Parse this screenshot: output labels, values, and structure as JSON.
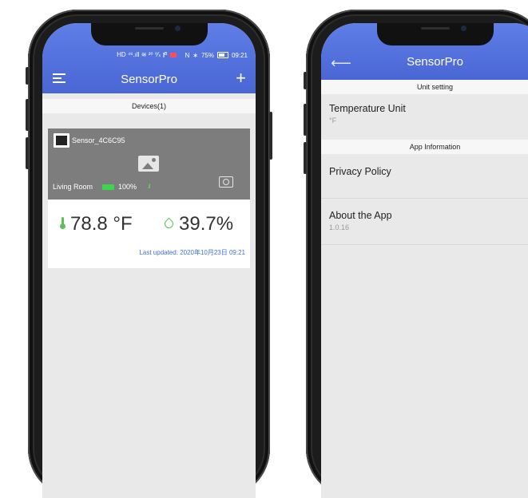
{
  "left_screen": {
    "status_bar": {
      "left_icons": "HD ⁴⁶.ıll ≋ ²⁰ ⁰⁄ₛ ⫾ᴮ",
      "nfc": "N",
      "bluetooth": "∗",
      "battery_pct": "75%",
      "time": "09:21"
    },
    "title": "SensorPro",
    "devices_label": "Devices(1)",
    "device": {
      "name": "Sensor_4C6C95",
      "room": "Living Room",
      "battery": "100%",
      "signal": ".ıl",
      "temperature": "78.8 °F",
      "humidity": "39.7%",
      "last_updated": "Last updated: 2020年10月23日 09:21"
    }
  },
  "right_screen": {
    "title": "SensorPro",
    "unit_setting_label": "Unit setting",
    "temperature_unit_label": "Temperature Unit",
    "temperature_unit_value": "°F",
    "app_info_label": "App Information",
    "privacy_policy_label": "Privacy Policy",
    "about_label": "About the App",
    "version": "1.0.16"
  },
  "colors": {
    "header_blue": "#4e6bd8",
    "accent_green": "#5cbf5c",
    "link_blue": "#3d6fe0"
  }
}
